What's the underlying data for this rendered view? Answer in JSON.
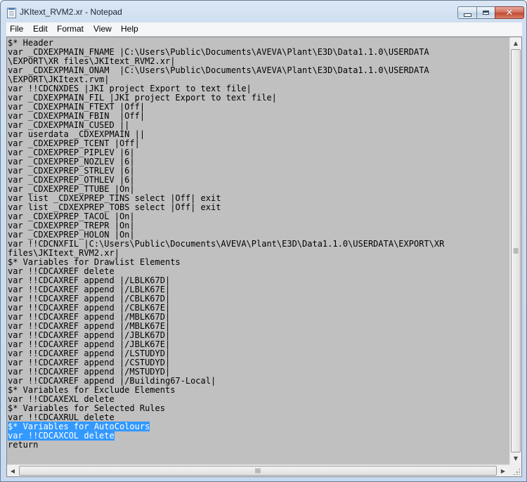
{
  "window": {
    "title": "JKItext_RVM2.xr - Notepad",
    "icon": "notepad-icon",
    "controls": {
      "minimize": "minimize-icon",
      "maximize": "maximize-icon",
      "close": "close-icon",
      "close_glyph": "✕"
    }
  },
  "menu": {
    "items": [
      {
        "label": "File"
      },
      {
        "label": "Edit"
      },
      {
        "label": "Format"
      },
      {
        "label": "View"
      },
      {
        "label": "Help"
      }
    ]
  },
  "editor": {
    "background": "#c0c0c0",
    "selection_color": "#3399ff",
    "lines": [
      {
        "text": "$* Header"
      },
      {
        "text": "var _CDXEXPMAIN_FNAME |C:\\Users\\Public\\Documents\\AVEVA\\Plant\\E3D\\Data1.1.0\\USERDATA"
      },
      {
        "text": "\\EXPORT\\XR files\\JKItext_RVM2.xr|"
      },
      {
        "text": "var _CDXEXPMAIN_ONAM  |C:\\Users\\Public\\Documents\\AVEVA\\Plant\\E3D\\Data1.1.0\\USERDATA"
      },
      {
        "text": "\\EXPORT\\JKItext.rvm|"
      },
      {
        "text": "var !!CDCNXDES |JKI project Export to text file|"
      },
      {
        "text": "var _CDXEXPMAIN_FIL |JKI project Export to text file|"
      },
      {
        "text": "var _CDXEXPMAIN_FTEXT |Off|"
      },
      {
        "text": "var _CDXEXPMAIN_FBIN  |Off|"
      },
      {
        "text": "var _CDXEXPMAIN_CUSED ||"
      },
      {
        "text": "var userdata _CDXEXPMAIN ||"
      },
      {
        "text": "var _CDXEXPREP_TCENT |Off|"
      },
      {
        "text": "var _CDXEXPREP_PIPLEV |6|"
      },
      {
        "text": "var _CDXEXPREP_NOZLEV |6|"
      },
      {
        "text": "var _CDXEXPREP_STRLEV |6|"
      },
      {
        "text": "var _CDXEXPREP_OTHLEV |6|"
      },
      {
        "text": "var _CDXEXPREP_TTUBE |On|"
      },
      {
        "text": "var list _CDXEXPREP_TINS select |Off| exit"
      },
      {
        "text": "var list _CDXEXPREP_TOBS select |Off| exit"
      },
      {
        "text": "var _CDXEXPREP_TACOL |On|"
      },
      {
        "text": "var _CDXEXPREP_TREPR |On|"
      },
      {
        "text": "var _CDXEXPREP_HOLON |On|"
      },
      {
        "text": "var !!CDCNXFIL |C:\\Users\\Public\\Documents\\AVEVA\\Plant\\E3D\\Data1.1.0\\USERDATA\\EXPORT\\XR"
      },
      {
        "text": "files\\JKItext_RVM2.xr|"
      },
      {
        "text": "$* Variables for Drawlist Elements"
      },
      {
        "text": "var !!CDCAXREF delete"
      },
      {
        "text": "var !!CDCAXREF append |/LBLK67D|"
      },
      {
        "text": "var !!CDCAXREF append |/LBLK67E|"
      },
      {
        "text": "var !!CDCAXREF append |/CBLK67D|"
      },
      {
        "text": "var !!CDCAXREF append |/CBLK67E|"
      },
      {
        "text": "var !!CDCAXREF append |/MBLK67D|"
      },
      {
        "text": "var !!CDCAXREF append |/MBLK67E|"
      },
      {
        "text": "var !!CDCAXREF append |/JBLK67D|"
      },
      {
        "text": "var !!CDCAXREF append |/JBLK67E|"
      },
      {
        "text": "var !!CDCAXREF append |/LSTUDYD|"
      },
      {
        "text": "var !!CDCAXREF append |/CSTUDYD|"
      },
      {
        "text": "var !!CDCAXREF append |/MSTUDYD|"
      },
      {
        "text": "var !!CDCAXREF append |/Building67-Local|"
      },
      {
        "text": "$* Variables for Exclude Elements"
      },
      {
        "text": "var !!CDCAXEXL delete"
      },
      {
        "text": "$* Variables for Selected Rules"
      },
      {
        "text": "var !!CDCAXRUL delete"
      },
      {
        "text": "$* Variables for AutoColours",
        "selected": true
      },
      {
        "text": "var !!CDCAXCOL delete",
        "selected": true
      },
      {
        "text": "return"
      }
    ]
  },
  "scrollbars": {
    "up_arrow": "▲",
    "down_arrow": "▼",
    "left_arrow": "◀",
    "right_arrow": "▶"
  }
}
